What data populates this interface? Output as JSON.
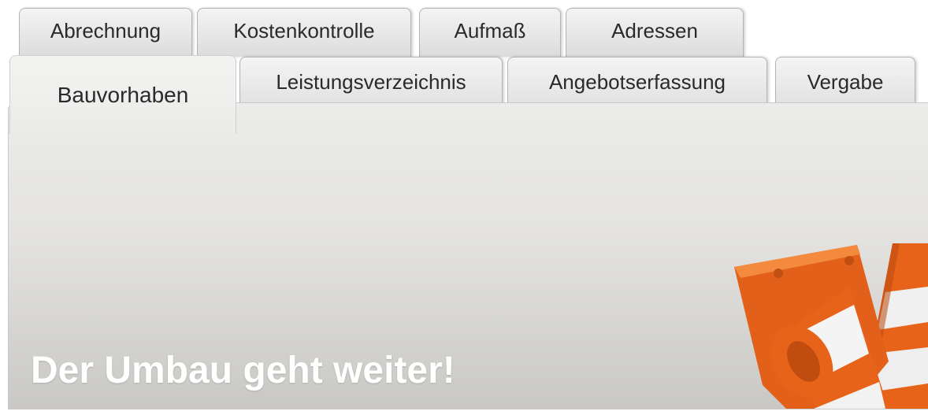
{
  "tabs_back": [
    "Abrechnung",
    "Kostenkontrolle",
    "Aufmaß",
    "Adressen"
  ],
  "tabs_front": [
    "Bauvorhaben",
    "Leistungsverzeichnis",
    "Angebotserfassung",
    "Vergabe"
  ],
  "active_tab": "Bauvorhaben",
  "headline": "Der Umbau geht weiter!",
  "illustration": "traffic-cones-illustration",
  "colors": {
    "cone_orange": "#e8631a",
    "cone_stripe": "#f2f2f2",
    "headline": "#ffffff"
  }
}
